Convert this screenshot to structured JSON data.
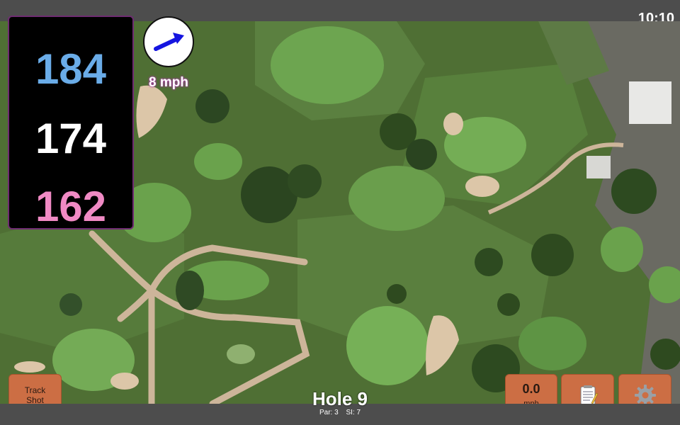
{
  "clock": "10:10",
  "distances": {
    "back": "184",
    "middle": "174",
    "front": "162",
    "colors": {
      "back": "#6aace8",
      "middle": "#ffffff",
      "front": "#f08ac4"
    }
  },
  "wind": {
    "speed": "8 mph",
    "icon": "wind-arrow-icon",
    "direction": "east-northeast"
  },
  "track_shot": {
    "label": "Track\nShot"
  },
  "speed_button": {
    "value": "0.0",
    "unit": "mph"
  },
  "notes_button": {
    "icon": "notepad-icon"
  },
  "settings_button": {
    "icon": "gear-icon"
  },
  "hole": {
    "title": "Hole 9",
    "par": "Par: 3",
    "si": "SI: 7"
  },
  "colors": {
    "button_bg": "#cc6e44",
    "panel_border": "#6f2c72",
    "bar_bg": "#4d4d4d"
  }
}
